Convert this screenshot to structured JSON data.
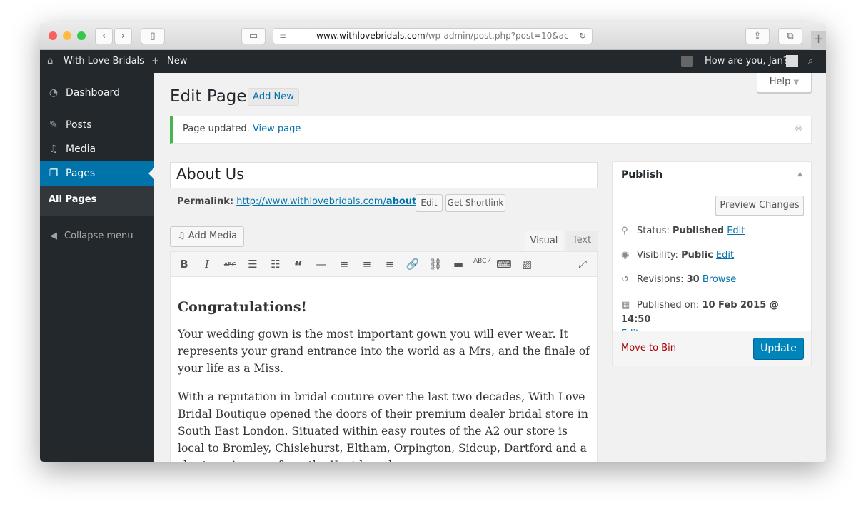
{
  "browser": {
    "url_domain": "www.withlovebridals.com",
    "url_path": "/wp-admin/post.php?post=10&ac"
  },
  "adminbar": {
    "site": "With Love Bridals",
    "new": "New",
    "greeting": "How are you, Jan?"
  },
  "sidebar": {
    "items": [
      {
        "label": "Dashboard",
        "icon": "dashboard-icon"
      },
      {
        "label": "Posts",
        "icon": "pin-icon"
      },
      {
        "label": "Media",
        "icon": "media-icon"
      },
      {
        "label": "Pages",
        "icon": "pages-icon"
      }
    ],
    "submenu": "All Pages",
    "collapse": "Collapse menu"
  },
  "header": {
    "title": "Edit Page",
    "add_new": "Add New",
    "help": "Help"
  },
  "notice": {
    "text": "Page updated.",
    "link": "View page"
  },
  "editor": {
    "title": "About Us",
    "permalink_label": "Permalink:",
    "permalink_base": "http://www.withlovebridals.com/",
    "permalink_slug": "about-us",
    "permalink_end": "/",
    "edit": "Edit",
    "shortlink": "Get Shortlink",
    "add_media": "Add Media",
    "tab_visual": "Visual",
    "tab_text": "Text",
    "heading": "Congratulations!",
    "paragraphs": [
      "Your wedding gown is the most important gown you will ever wear. It represents your grand entrance into the world as a Mrs, and the finale of your life as a Miss.",
      "With a reputation in bridal couture over the last two decades, With Love Bridal Boutique opened the doors of their premium dealer bridal store in South East London. Situated within easy routes of the A2 our store is local to Bromley, Chislehurst, Eltham, Orpington, Sidcup, Dartford and a short car journey from the Kent boarders."
    ]
  },
  "publish": {
    "title": "Publish",
    "preview": "Preview Changes",
    "status_label": "Status:",
    "status": "Published",
    "visibility_label": "Visibility:",
    "visibility": "Public",
    "revisions_label": "Revisions:",
    "revisions": "30",
    "browse": "Browse",
    "published_label": "Published on:",
    "published": "10 Feb 2015 @ 14:50",
    "edit": "Edit",
    "move_to_bin": "Move to Bin",
    "update": "Update"
  },
  "colors": {
    "accent": "#0073aa",
    "admin_dark": "#23282d",
    "update_button": "#0085ba",
    "trash": "#a00",
    "notice": "#46b450"
  }
}
